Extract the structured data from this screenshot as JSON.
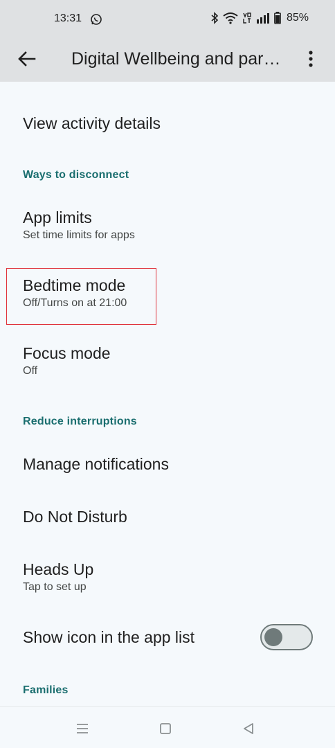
{
  "status_bar": {
    "time": "13:31",
    "battery": "85%"
  },
  "app_bar": {
    "title": "Digital Wellbeing and parental controls"
  },
  "items": {
    "view_activity": {
      "title": "View activity details"
    },
    "ways_header": "Ways to disconnect",
    "app_limits": {
      "title": "App limits",
      "subtitle": "Set time limits for apps"
    },
    "bedtime": {
      "title": "Bedtime mode",
      "subtitle": "Off/Turns on at 21:00"
    },
    "focus": {
      "title": "Focus mode",
      "subtitle": "Off"
    },
    "reduce_header": "Reduce interruptions",
    "manage_notifications": {
      "title": "Manage notifications"
    },
    "dnd": {
      "title": "Do Not Disturb"
    },
    "heads_up": {
      "title": "Heads Up",
      "subtitle": "Tap to set up"
    },
    "show_icon": {
      "title": "Show icon in the app list",
      "toggle_on": false
    },
    "families_header": "Families"
  },
  "colors": {
    "accent": "#1a6e6f",
    "highlight": "#e0333c",
    "appbar": "#dfe1e3",
    "background": "#f5f9fc"
  },
  "icons": {
    "back": "arrow-left-icon",
    "more": "more-vert-icon",
    "whatsapp": "whatsapp-icon",
    "bluetooth": "bluetooth-icon",
    "wifi": "wifi-icon",
    "volte": "volte-icon",
    "signal": "signal-icon",
    "battery": "battery-icon",
    "nav_menu": "menu-icon",
    "nav_home": "home-square-icon",
    "nav_back": "back-triangle-icon"
  }
}
